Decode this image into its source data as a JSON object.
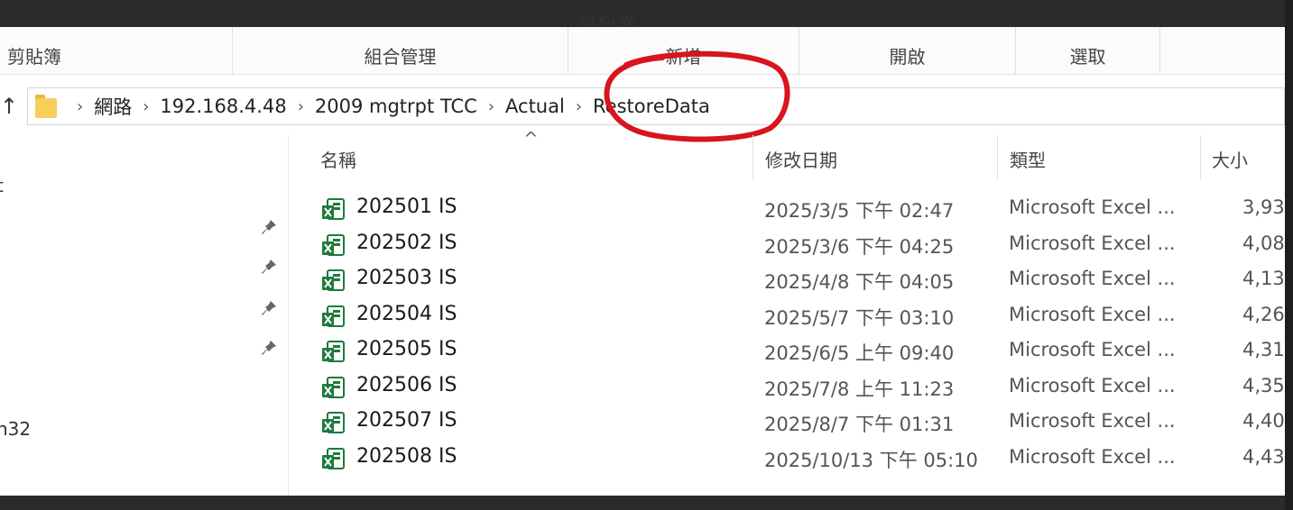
{
  "ribbon": {
    "cut_label": "資料夾",
    "groups": [
      "剪貼簿",
      "組合管理",
      "新增",
      "開啟",
      "選取"
    ]
  },
  "address": {
    "up_icon": "up-arrow-icon",
    "crumbs": [
      "網路",
      "192.168.4.48",
      "2009 mgtrpt TCC",
      "Actual",
      "RestoreData"
    ],
    "separator": "›"
  },
  "nav": {
    "fragments": [
      "t",
      "h32"
    ]
  },
  "columns": {
    "name": "名稱",
    "date": "修改日期",
    "type": "類型",
    "size": "大小",
    "sort_indicator": "^"
  },
  "files": [
    {
      "name": "202501 IS",
      "date": "2025/3/5 下午 02:47",
      "type": "Microsoft Excel ...",
      "size": "3,93"
    },
    {
      "name": "202502 IS",
      "date": "2025/3/6 下午 04:25",
      "type": "Microsoft Excel ...",
      "size": "4,08"
    },
    {
      "name": "202503 IS",
      "date": "2025/4/8 下午 04:05",
      "type": "Microsoft Excel ...",
      "size": "4,13"
    },
    {
      "name": "202504 IS",
      "date": "2025/5/7 下午 03:10",
      "type": "Microsoft Excel ...",
      "size": "4,26"
    },
    {
      "name": "202505 IS",
      "date": "2025/6/5 上午 09:40",
      "type": "Microsoft Excel ...",
      "size": "4,31"
    },
    {
      "name": "202506 IS",
      "date": "2025/7/8 上午 11:23",
      "type": "Microsoft Excel ...",
      "size": "4,35"
    },
    {
      "name": "202507 IS",
      "date": "2025/8/7 下午 01:31",
      "type": "Microsoft Excel ...",
      "size": "4,40"
    },
    {
      "name": "202508 IS",
      "date": "2025/10/13 下午 05:10",
      "type": "Microsoft Excel ...",
      "size": "4,43"
    }
  ],
  "colors": {
    "annotation": "#d8141e",
    "excel_green": "#1e7a3c",
    "folder_yellow": "#f7cf5a"
  }
}
